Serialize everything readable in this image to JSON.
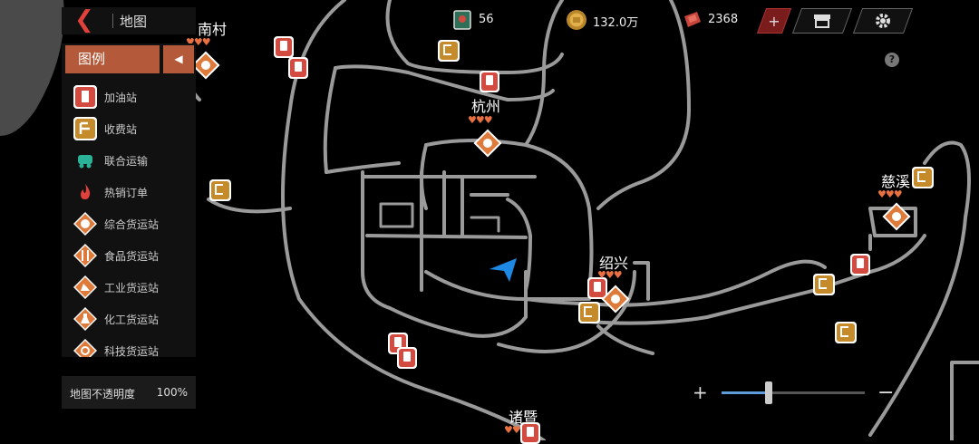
{
  "header": {
    "title": "地图",
    "back_icon": "back-chevron-icon"
  },
  "legend": {
    "title": "图例",
    "items": [
      {
        "label": "加油站",
        "icon": "gas-station-icon",
        "color": "#d24a40"
      },
      {
        "label": "收费站",
        "icon": "toll-station-icon",
        "color": "#c58a2a"
      },
      {
        "label": "联合运输",
        "icon": "joint-transport-icon",
        "color": "#2bb39a"
      },
      {
        "label": "热销订单",
        "icon": "fire-icon",
        "color": "#e0413b"
      },
      {
        "label": "综合货运站",
        "icon": "general-cargo-icon",
        "color": "#de7a3a"
      },
      {
        "label": "食品货运站",
        "icon": "food-cargo-icon",
        "color": "#de7a3a"
      },
      {
        "label": "工业货运站",
        "icon": "industrial-cargo-icon",
        "color": "#de7a3a"
      },
      {
        "label": "化工货运站",
        "icon": "chemical-cargo-icon",
        "color": "#de7a3a"
      },
      {
        "label": "科技货运站",
        "icon": "tech-cargo-icon",
        "color": "#de7a3a"
      }
    ]
  },
  "opacity": {
    "label": "地图不透明度",
    "value": "100%"
  },
  "stats": {
    "cards": "56",
    "coins": "132.0万",
    "gems": "2368"
  },
  "buttons": {
    "add": "+",
    "shop_icon": "shop-icon",
    "settings_icon": "gear-icon",
    "help": "?"
  },
  "cities": [
    {
      "name": "南村",
      "hearts": "♥♥♥"
    },
    {
      "name": "杭州",
      "hearts": "♥♥♥"
    },
    {
      "name": "绍兴",
      "hearts": "♥♥♥"
    },
    {
      "name": "慈溪",
      "hearts": "♥♥♥"
    },
    {
      "name": "诸暨",
      "hearts": "♥♥"
    }
  ],
  "zoom": {
    "plus": "+",
    "minus": "−",
    "level": 0.33
  },
  "colors": {
    "accent": "#b4593a",
    "road": "#9a9a9a",
    "player": "#1e88e5"
  }
}
